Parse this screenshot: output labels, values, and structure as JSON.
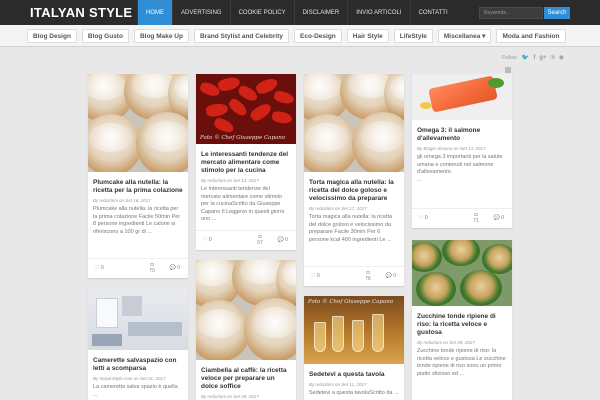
{
  "site": {
    "logo": "ITALYAN STYLE"
  },
  "topnav": [
    "HOME",
    "ADVERTISING",
    "COOKIE POLICY",
    "DISCLAIMER",
    "INVIO ARTICOLI",
    "CONTATTI"
  ],
  "search": {
    "placeholder": "Keywords...",
    "button": "Search"
  },
  "categories": [
    "Blog Design",
    "Blog Gusto",
    "Blog Make Up",
    "Brand Stylist and Celebrity",
    "Eco-Design",
    "Hair Style",
    "LifeStyle",
    "Miscellanea ▾",
    "Moda and Fashion"
  ],
  "follow": {
    "label": "Follow:",
    "icons": [
      "twitter-icon",
      "facebook-icon",
      "google-plus-icon",
      "pinterest-icon",
      "rss-icon"
    ]
  },
  "cards": [
    {
      "image": "donuts",
      "title": "Plumcake alla nutella: la ricetta per la prima colazione",
      "meta": "By redazioni  on Set 16, 2017",
      "excerpt": "Plumcake alla nutella: la ricetta per la prima colazione Facile 50min Per 8 persone ingredienti Le calorie si riferiscono a 100 gr di ...",
      "likes": "0",
      "views": "70",
      "comments": "0"
    },
    {
      "image": "chili",
      "watermark": "Foto © Chef Giuseppe Capano",
      "title": "Le interessanti tendenze del mercato alimentare come stimolo per la cucina",
      "meta": "By redazioni  on Set 14, 2017",
      "excerpt": "Le interessanti tendenze del mercato alimentare come stimolo per la cucinaScritto da Giuseppe Capano Il Leggevo in questi giorni uno ...",
      "likes": "0",
      "views": "57",
      "comments": "0"
    },
    {
      "image": "donuts",
      "title": "Torta magica alla nutella: la ricetta del dolce goloso e velocissimo da preparare",
      "meta": "By redazioni  on Set 17, 2017",
      "excerpt": "Torta magica alla nutella: la ricetta del dolce goloso e velocissimo da preparare Facile 30min Per 6 persone kcal 400 ingredienti Le ...",
      "likes": "0",
      "views": "76",
      "comments": "0"
    },
    {
      "image": "salmon",
      "title": "Omega 3: il salmone d'allevamento",
      "meta": "By Biagio Simona  on Set 13, 2017",
      "excerpt": "gli omega 3 importanti per la salute umana e contenuti nel salmone d'allevamento",
      "more": "...",
      "likes": "0",
      "views": "71",
      "comments": "0"
    },
    {
      "image": "room",
      "title": "Camerette salvaspazio con letti a scomparsa",
      "meta": "By ItalyanStyle.com  on Set 01, 2017",
      "excerpt": "La cameretta salva spazio è quella ..."
    },
    {
      "image": "donuts",
      "title": "Ciambella al caffè: la ricetta veloce per preparare un dolce soffice",
      "meta": "By redazioni  on Set 09, 2017"
    },
    {
      "image": "drinks",
      "watermark": "Foto © Chef Giuseppe Capano",
      "title": "Sedetevi a questa tavola",
      "meta": "By redazioni  on Set 11, 2017",
      "excerpt": "Sedetevi a questa tavolaScritto da ..."
    },
    {
      "image": "zucchini",
      "title": "Zucchine tonde ripiene di riso: la ricetta veloce e gustosa",
      "meta": "By redazioni  on Set 08, 2017",
      "excerpt": "Zucchine tonde ripiene di riso: la ricetta veloce e gustosa Le zucchine tonde ripiene di riso sono un primo piatto sfizioso ed ..."
    }
  ],
  "colors": {
    "accent": "#2f8ed6",
    "topbar": "#2b2b2b",
    "background": "#e8e8e8"
  }
}
